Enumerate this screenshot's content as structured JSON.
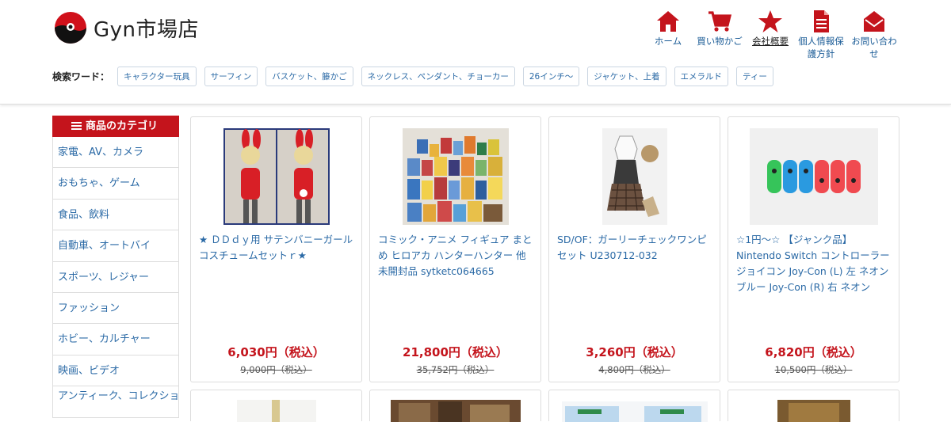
{
  "site": {
    "name": "Gyn市場店"
  },
  "nav": [
    {
      "label": "ホーム",
      "icon": "home-icon"
    },
    {
      "label": "買い物かご",
      "icon": "cart-icon"
    },
    {
      "label": "会社概要",
      "icon": "star-icon"
    },
    {
      "label": "個人情報保護方針",
      "icon": "document-icon"
    },
    {
      "label": "お問い合わせ",
      "icon": "mail-icon"
    }
  ],
  "keywords": {
    "label": "検索ワード：",
    "tags": [
      "キャラクター玩具",
      "サーフィン",
      "バスケット、籐かご",
      "ネックレス、ペンダント、チョーカー",
      "26インチ～",
      "ジャケット、上着",
      "エメラルド",
      "ティー"
    ]
  },
  "sidebar": {
    "title": "商品のカテゴリ",
    "items": [
      "家電、AV、カメラ",
      "おもちゃ、ゲーム",
      "食品、飲料",
      "自動車、オートバイ",
      "スポーツ、レジャー",
      "ファッション",
      "ホビー、カルチャー",
      "映画、ビデオ",
      "アンティーク、コレクション"
    ]
  },
  "products": [
    {
      "title": "★ ＤＤｄｙ用 サテンバニーガールコスチュームセットｒ★",
      "price": "6,030円（税込）",
      "old_price": "9,000円（税込）"
    },
    {
      "title": "コミック・アニメ フィギュア まとめ ヒロアカ ハンターハンター 他 未開封品 sytketc064665",
      "price": "21,800円（税込）",
      "old_price": "35,752円（税込）"
    },
    {
      "title": "SD/OF：ガーリーチェックワンピセット U230712-032",
      "price": "3,260円（税込）",
      "old_price": "4,800円（税込）"
    },
    {
      "title": "☆1円～☆ 【ジャンク品】 Nintendo Switch コントローラー ジョイコン Joy-Con (L) 左 ネオンブルー Joy-Con (R) 右 ネオン",
      "price": "6,820円（税込）",
      "old_price": "10,500円（税込）"
    }
  ],
  "colors": {
    "brand": "#c4141c",
    "link": "#2b6aa6"
  }
}
